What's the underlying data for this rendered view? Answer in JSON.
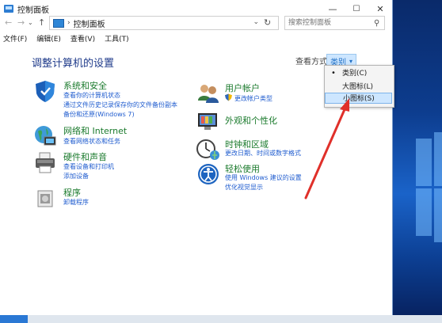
{
  "window": {
    "title": "控制面板",
    "controls": {
      "minimize": "—",
      "maximize": "☐",
      "close": "✕"
    }
  },
  "address": {
    "back": "←",
    "forward": "→",
    "up": "↑",
    "path_separator": "›",
    "path": "控制面板",
    "dropdown": "⌄",
    "refresh": "↻",
    "search_placeholder": "搜索控制面板",
    "search_icon": "⚲"
  },
  "menu": {
    "items": [
      "文件(F)",
      "编辑(E)",
      "查看(V)",
      "工具(T)"
    ]
  },
  "main": {
    "heading": "调整计算机的设置",
    "view_by_label": "查看方式:",
    "view_by_value": "类别",
    "view_by_caret": "▾"
  },
  "dropdown": {
    "items": [
      {
        "label": "类别(C)",
        "selected": true
      },
      {
        "label": "大图标(L)",
        "selected": false
      },
      {
        "label": "小图标(S)",
        "selected": false
      }
    ],
    "bullet": "•"
  },
  "categories": {
    "system": {
      "title": "系统和安全",
      "links": [
        "查看你的计算机状态",
        "通过文件历史记录保存你的文件备份副本",
        "备份和还原(Windows 7)"
      ]
    },
    "network": {
      "title": "网络和 Internet",
      "links": [
        "查看网络状态和任务"
      ]
    },
    "hardware": {
      "title": "硬件和声音",
      "links": [
        "查看设备和打印机",
        "添加设备"
      ]
    },
    "programs": {
      "title": "程序",
      "links": [
        "卸载程序"
      ]
    },
    "users": {
      "title": "用户帐户",
      "links": [
        "更改帐户类型"
      ]
    },
    "appearance": {
      "title": "外观和个性化",
      "links": []
    },
    "clock": {
      "title": "时钟和区域",
      "links": [
        "更改日期、时间或数字格式"
      ]
    },
    "ease": {
      "title": "轻松使用",
      "links": [
        "使用 Windows 建议的设置",
        "优化视觉显示"
      ]
    }
  },
  "colors": {
    "accent": "#1f5ccf",
    "category_title": "#1a7a2c",
    "arrow": "#e0302a",
    "highlight": "#cde6ff"
  }
}
